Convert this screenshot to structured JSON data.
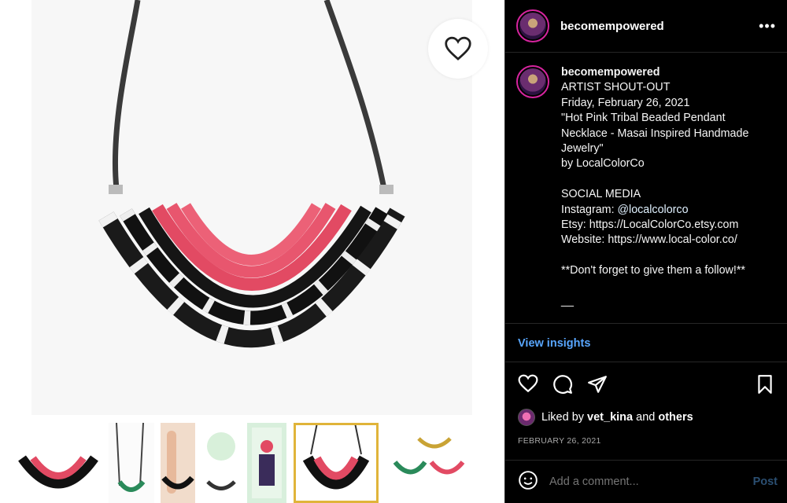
{
  "post": {
    "username": "becomempowered",
    "more_label": "•••",
    "caption_lines": [
      "ARTIST SHOUT-OUT",
      "Friday, February 26, 2021",
      "\"Hot Pink Tribal Beaded Pendant",
      "Necklace - Masai Inspired Handmade",
      "Jewelry\"",
      "by LocalColorCo",
      "",
      "SOCIAL MEDIA"
    ],
    "instagram_prefix": "Instagram: ",
    "instagram_handle": "@localcolorco",
    "etsy_line": "Etsy: https://LocalColorCo.etsy.com",
    "website_line": "Website: https://www.local-color.co/",
    "follow_line": "**Don't forget to give them a follow!**",
    "end_line": "__"
  },
  "insights_label": "View insights",
  "likes": {
    "prefix": "Liked by ",
    "user": "vet_kina",
    "middle": " and ",
    "others": "others"
  },
  "date": "FEBRUARY 26, 2021",
  "comment": {
    "placeholder": "Add a comment...",
    "post_label": "Post"
  },
  "icons": {
    "like": "heart-icon",
    "comment": "comment-bubble-icon",
    "share": "paper-plane-icon",
    "save": "bookmark-icon",
    "emoji": "smiley-icon",
    "more": "ellipsis-icon"
  },
  "colors": {
    "link": "#58a6ff",
    "accent_ring": "#d6249f",
    "selected_thumb": "#e0b43a"
  }
}
